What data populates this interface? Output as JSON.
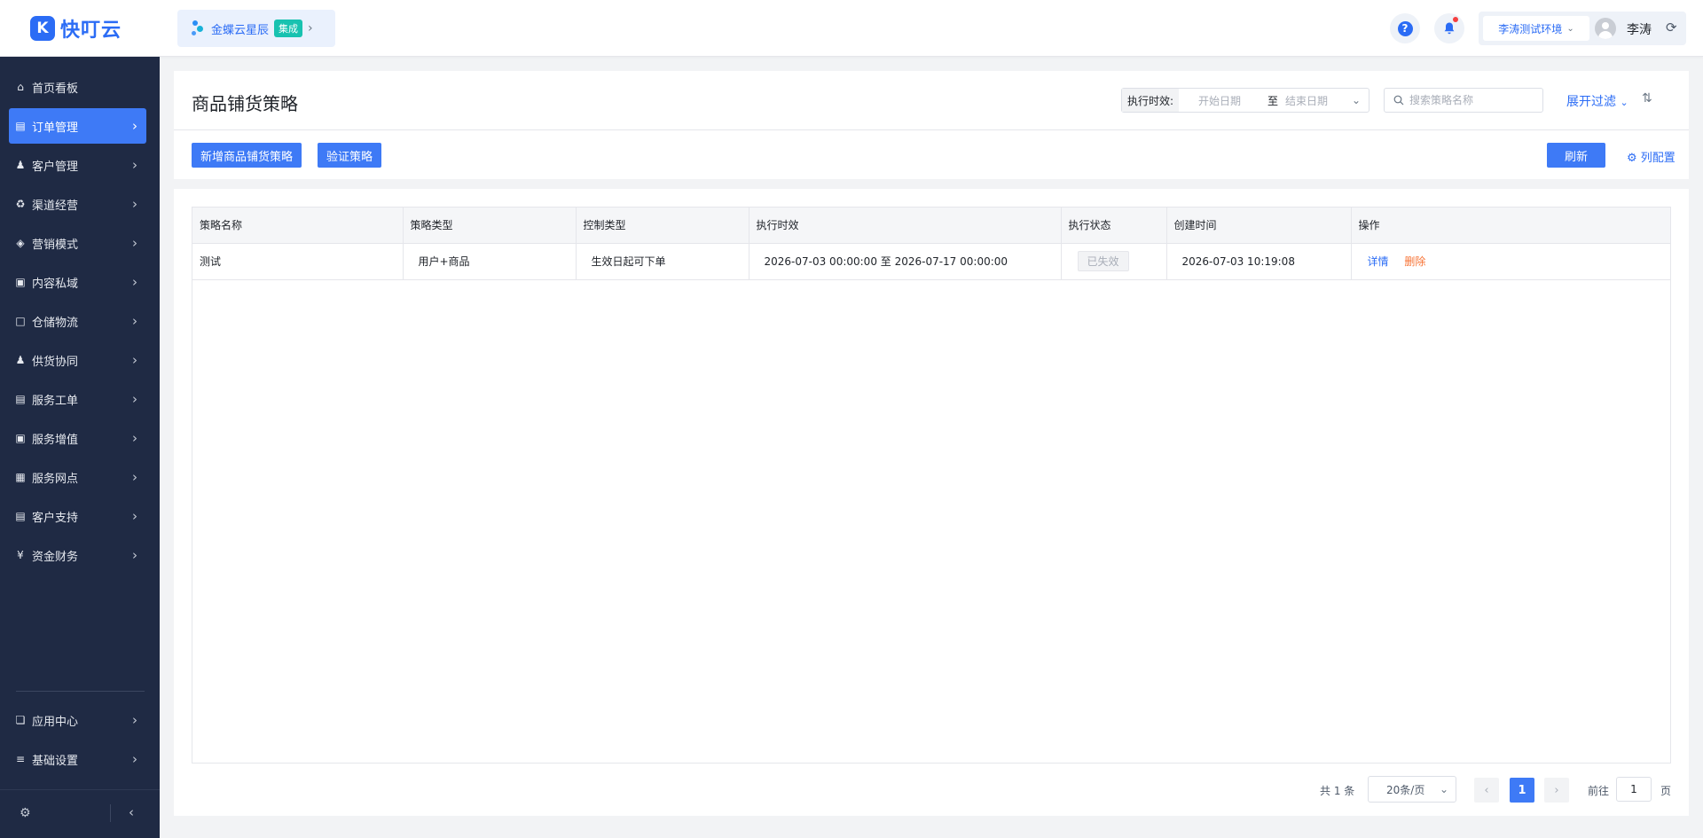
{
  "header": {
    "logo_mark": "K",
    "logo_text": "快叮云",
    "app_switch": {
      "name": "金蝶云星辰",
      "badge": "集成"
    },
    "help_glyph": "?",
    "environment": "李涛测试环境",
    "user_name": "李涛",
    "icons": [
      "help-icon",
      "bell-icon",
      "chevron-down-icon",
      "avatar",
      "refresh-icon"
    ]
  },
  "sidebar": {
    "items": [
      {
        "label": "首页看板",
        "icon": "home-icon",
        "has_chevron": false
      },
      {
        "label": "订单管理",
        "icon": "order-icon",
        "active": true
      },
      {
        "label": "客户管理",
        "icon": "user-icon"
      },
      {
        "label": "渠道经营",
        "icon": "channel-icon"
      },
      {
        "label": "营销模式",
        "icon": "tag-icon"
      },
      {
        "label": "内容私域",
        "icon": "image-icon"
      },
      {
        "label": "仓储物流",
        "icon": "warehouse-icon"
      },
      {
        "label": "供货协同",
        "icon": "supply-icon"
      },
      {
        "label": "服务工单",
        "icon": "ticket-icon"
      },
      {
        "label": "服务增值",
        "icon": "bag-icon"
      },
      {
        "label": "服务网点",
        "icon": "store-icon"
      },
      {
        "label": "客户支持",
        "icon": "support-icon"
      },
      {
        "label": "资金财务",
        "icon": "yen-icon"
      }
    ],
    "bottom_items": [
      {
        "label": "应用中心",
        "icon": "cube-icon"
      },
      {
        "label": "基础设置",
        "icon": "settings-icon"
      }
    ]
  },
  "page": {
    "title": "商品铺货策略",
    "filters": {
      "date_label": "执行时效:",
      "start_placeholder": "开始日期",
      "separator": "至",
      "end_placeholder": "结束日期",
      "search_placeholder": "搜索策略名称",
      "expand_label": "展开过滤"
    },
    "toolbar": {
      "add_label": "新增商品铺货策略",
      "verify_label": "验证策略",
      "refresh_label": "刷新",
      "column_config_label": "列配置"
    }
  },
  "table": {
    "columns": [
      "策略名称",
      "策略类型",
      "控制类型",
      "执行时效",
      "执行状态",
      "创建时间",
      "操作"
    ],
    "rows": [
      {
        "name": "测试",
        "type": "用户+商品",
        "control": "生效日起可下单",
        "period": "2026-07-03 00:00:00 至 2026-07-17 00:00:00",
        "status": "已失效",
        "created": "2026-07-03 10:19:08",
        "action_detail": "详情",
        "action_delete": "删除"
      }
    ]
  },
  "pagination": {
    "total": "共 1 条",
    "page_size": "20条/页",
    "current_page": "1",
    "goto_label": "前往",
    "goto_value": "1",
    "unit": "页"
  },
  "colors": {
    "primary": "#3e7af6",
    "sidebar_bg": "#1f2a44",
    "danger_link": "#f77234",
    "badge_teal": "#18c2b0"
  }
}
